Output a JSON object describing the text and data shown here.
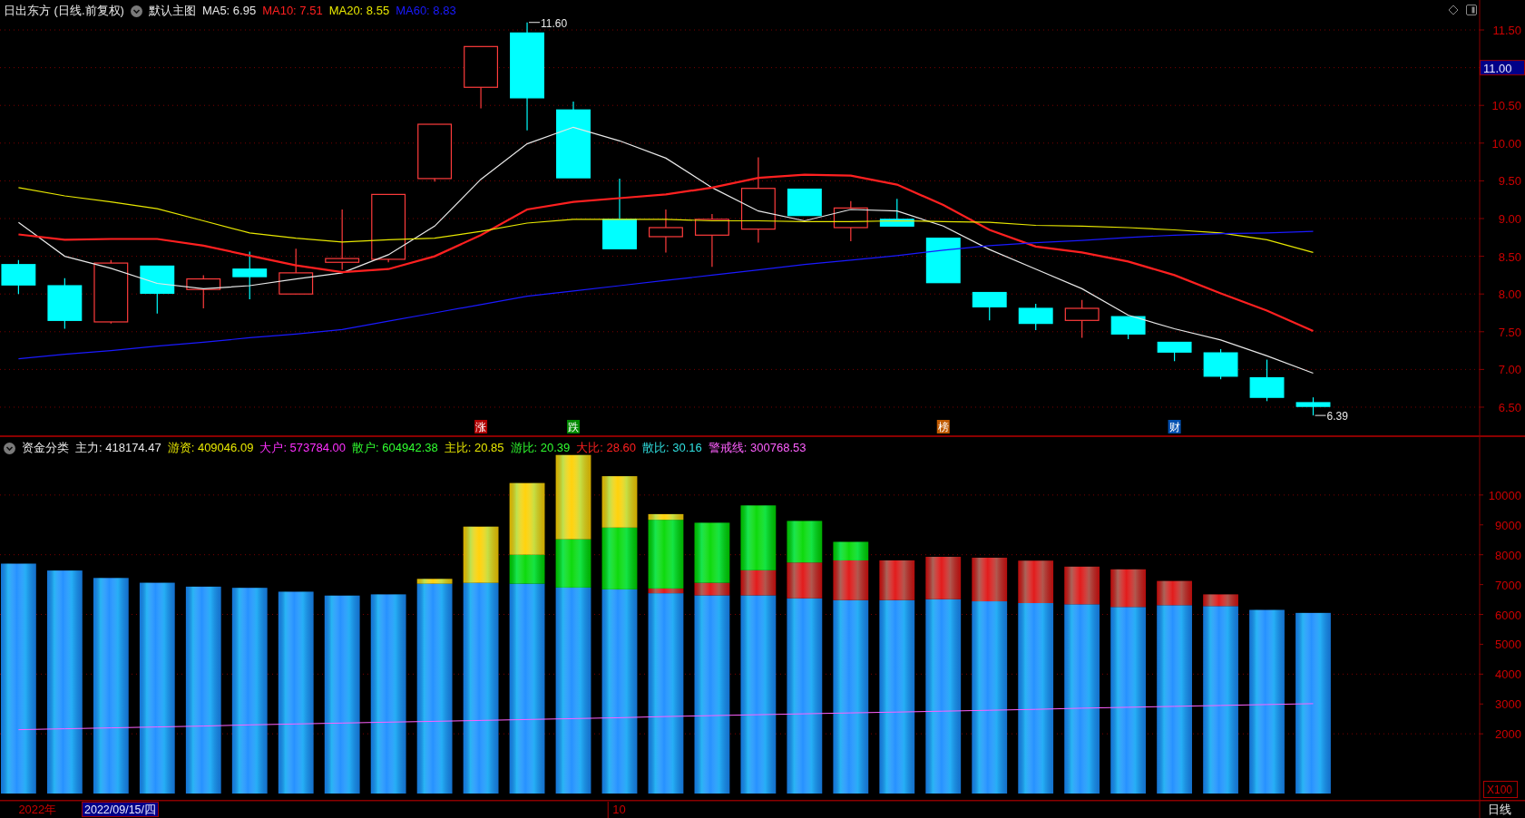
{
  "main_chart": {
    "title": "日出东方 (日线.前复权)",
    "template": "默认主图",
    "legend": [
      {
        "label": "MA5: 6.95",
        "color": "#e8e8e8"
      },
      {
        "label": "MA10: 7.51",
        "color": "#ff2020"
      },
      {
        "label": "MA20: 8.55",
        "color": "#e8e800"
      },
      {
        "label": "MA60: 8.83",
        "color": "#1a1aff"
      }
    ],
    "cursor_price": "11.00",
    "event_badges": [
      {
        "color": "#b00000"
      },
      {
        "color": "#008a00"
      },
      {
        "color": "#c05a00"
      },
      {
        "color": "#0050b0"
      }
    ],
    "chart_data": {
      "type": "line",
      "grid": true,
      "ylim": [
        6.115,
        11.897
      ],
      "categories": [
        null,
        null,
        null,
        null,
        null,
        null,
        null,
        null,
        null,
        null,
        "涨",
        null,
        "跌",
        null,
        null,
        null,
        null,
        null,
        null,
        null,
        "榜",
        null,
        null,
        null,
        null,
        "财",
        null,
        null,
        null
      ],
      "yticks": [
        {
          "value": 11.5,
          "label": "11.50"
        },
        {
          "value": 10.5,
          "label": "10.50"
        },
        {
          "value": 10,
          "label": "10.00"
        },
        {
          "value": 9.5,
          "label": "9.50"
        },
        {
          "value": 9,
          "label": "9.00"
        },
        {
          "value": 8.5,
          "label": "8.50"
        },
        {
          "value": 8,
          "label": "8.00"
        },
        {
          "value": 7.5,
          "label": "7.50"
        },
        {
          "value": 7,
          "label": "7.00"
        },
        {
          "value": 6.5,
          "label": "6.50"
        }
      ],
      "series": [
        {
          "color": "#e8e8e8",
          "values": [
            8.95,
            8.5,
            8.34,
            8.14,
            8.07,
            8.11,
            8.2,
            8.28,
            8.52,
            8.9,
            9.52,
            9.99,
            10.21,
            10.03,
            9.8,
            9.41,
            9.1,
            8.97,
            9.12,
            9.1,
            8.9,
            8.59,
            8.33,
            8.07,
            7.72,
            7.54,
            7.39,
            7.18,
            6.95
          ]
        },
        {
          "color": "#ff2020",
          "values": [
            8.79,
            8.72,
            8.73,
            8.73,
            8.64,
            8.51,
            8.38,
            8.29,
            8.33,
            8.5,
            8.78,
            9.12,
            9.22,
            9.27,
            9.32,
            9.41,
            9.54,
            9.58,
            9.57,
            9.45,
            9.18,
            8.85,
            8.63,
            8.55,
            8.43,
            8.25,
            8.01,
            7.78,
            7.51
          ]
        },
        {
          "color": "#e8e800",
          "values": [
            9.41,
            9.3,
            9.22,
            9.13,
            8.97,
            8.81,
            8.74,
            8.69,
            8.72,
            8.74,
            8.83,
            8.94,
            8.99,
            8.99,
            8.99,
            8.97,
            8.97,
            8.96,
            8.96,
            8.97,
            8.96,
            8.95,
            8.91,
            8.9,
            8.88,
            8.85,
            8.81,
            8.72,
            8.55
          ]
        },
        {
          "color": "#1a1aff",
          "values": [
            7.14,
            7.2,
            7.25,
            7.31,
            7.36,
            7.42,
            7.47,
            7.53,
            7.64,
            7.75,
            7.86,
            7.97,
            8.04,
            8.11,
            8.18,
            8.25,
            8.32,
            8.39,
            8.45,
            8.51,
            8.58,
            8.64,
            8.68,
            8.71,
            8.75,
            8.78,
            8.8,
            8.81,
            8.83
          ]
        }
      ],
      "annotations": [
        "11.60",
        "6.39"
      ]
    }
  },
  "indicator": {
    "title": "资金分类",
    "legend": [
      {
        "label": "主力: 418174.47",
        "color": "#e8e8e8"
      },
      {
        "label": "游资: 409046.09",
        "color": "#e8e800"
      },
      {
        "label": "大户: 573784.00",
        "color": "#ff30ff"
      },
      {
        "label": "散户: 604942.38",
        "color": "#30ff30"
      },
      {
        "label": "主比: 20.85",
        "color": "#e8e800"
      },
      {
        "label": "游比: 20.39",
        "color": "#30ff30"
      },
      {
        "label": "大比: 28.60",
        "color": "#ff2020"
      },
      {
        "label": "散比: 30.16",
        "color": "#30e0e0"
      },
      {
        "label": "警戒线: 300768.53",
        "color": "#ff60ff"
      }
    ],
    "axis_unit": "X100",
    "chart_data": {
      "type": "bar",
      "stacked": true,
      "grid": true,
      "ylim": [
        -212,
        11970
      ],
      "categories": [
        "2022年",
        null,
        null,
        null,
        null,
        null,
        null,
        null,
        null,
        null,
        null,
        null,
        null,
        "10",
        null,
        null,
        null,
        null,
        null,
        null,
        null,
        null,
        null,
        null,
        null,
        null,
        null,
        null,
        null
      ],
      "yticks": [
        10000,
        9000,
        8000,
        7000,
        6000,
        5000,
        4000,
        3000,
        2000
      ],
      "series": [
        {
          "color": "#1a8cff",
          "values": [
            7700,
            7470,
            7220,
            7060,
            6930,
            6890,
            6760,
            6630,
            6670,
            7030,
            7060,
            7030,
            6900,
            6840,
            6710,
            6640,
            6640,
            6540,
            6480,
            6480,
            6510,
            6440,
            6380,
            6340,
            6250,
            6310,
            6280,
            6150,
            6050
          ]
        },
        {
          "color": "#e01010",
          "values": [
            null,
            null,
            null,
            null,
            null,
            null,
            null,
            null,
            null,
            null,
            null,
            null,
            null,
            null,
            160,
            420,
            840,
            1200,
            1330,
            1330,
            1420,
            1460,
            1420,
            1260,
            1260,
            810,
            390,
            null,
            null
          ]
        },
        {
          "color": "#00d800",
          "values": [
            null,
            null,
            null,
            null,
            null,
            null,
            null,
            null,
            null,
            null,
            null,
            970,
            1620,
            2070,
            2300,
            2010,
            2170,
            1390,
            620,
            null,
            null,
            null,
            null,
            null,
            null,
            null,
            null,
            null,
            null
          ]
        },
        {
          "color": "#ffd000",
          "values": [
            null,
            null,
            null,
            null,
            null,
            null,
            null,
            null,
            null,
            160,
            1880,
            2400,
            2820,
            1720,
            190,
            null,
            null,
            null,
            null,
            null,
            null,
            null,
            null,
            null,
            null,
            null,
            null,
            null,
            null
          ]
        },
        {
          "type": "line",
          "color": "#ff60ff",
          "values": [
            2140,
            2170,
            2200,
            2230,
            2260,
            2300,
            2330,
            2360,
            2390,
            2420,
            2450,
            2480,
            2510,
            2540,
            2580,
            2610,
            2640,
            2670,
            2700,
            2730,
            2760,
            2790,
            2820,
            2860,
            2890,
            2920,
            2950,
            2980,
            3010
          ]
        }
      ]
    }
  },
  "time_axis": {
    "cursor_date": "2022/09/15/四",
    "period": "日线"
  }
}
